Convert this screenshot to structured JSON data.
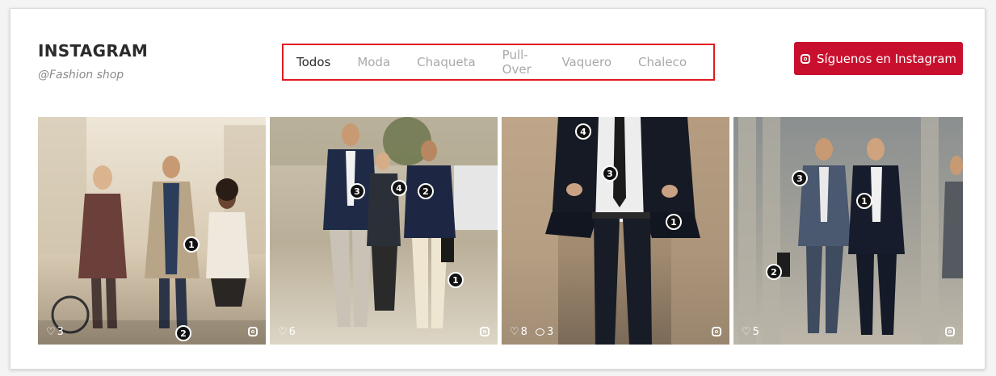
{
  "brand": {
    "title": "INSTAGRAM",
    "handle": "@Fashion shop"
  },
  "tabs": [
    {
      "label": "Todos",
      "active": true
    },
    {
      "label": "Moda",
      "active": false
    },
    {
      "label": "Chaqueta",
      "active": false
    },
    {
      "label": "Pull-Over",
      "active": false
    },
    {
      "label": "Vaquero",
      "active": false
    },
    {
      "label": "Chaleco",
      "active": false
    }
  ],
  "follow_button": {
    "label": "Síguenos en Instagram",
    "icon": "instagram-icon"
  },
  "colors": {
    "accent": "#c8102e",
    "highlight_border": "#e01a22"
  },
  "photos": [
    {
      "likes": "3",
      "comments": "",
      "hotspots": [
        "1",
        "2"
      ]
    },
    {
      "likes": "6",
      "comments": "",
      "hotspots": [
        "3",
        "4",
        "2",
        "1"
      ]
    },
    {
      "likes": "8",
      "comments": "3",
      "hotspots": [
        "4",
        "3",
        "1"
      ]
    },
    {
      "likes": "5",
      "comments": "",
      "hotspots": [
        "3",
        "1",
        "2"
      ]
    }
  ]
}
